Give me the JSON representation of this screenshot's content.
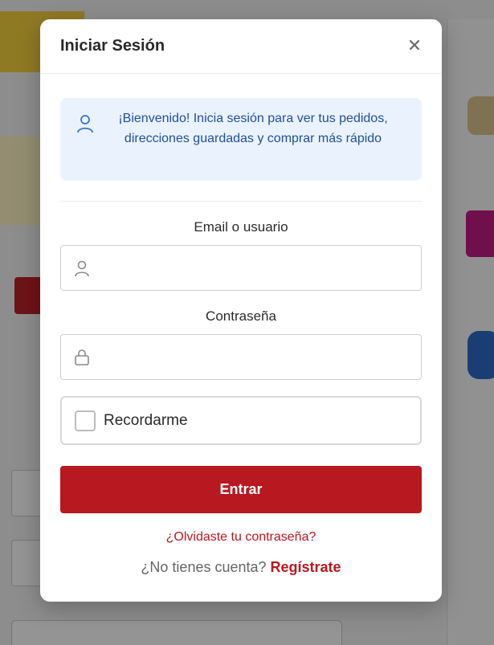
{
  "modal": {
    "title": "Iniciar Sesión",
    "close_icon": "close-icon",
    "info": {
      "icon": "user-icon",
      "text": "¡Bienvenido! Inicia sesión para ver tus pedidos, direcciones guardadas y comprar más rápido"
    },
    "email": {
      "label": "Email o usuario",
      "icon": "user-icon",
      "value": "",
      "placeholder": ""
    },
    "password": {
      "label": "Contraseña",
      "icon": "lock-icon",
      "value": "",
      "placeholder": ""
    },
    "remember": {
      "label": "Recordarme",
      "checked": false
    },
    "submit_label": "Entrar",
    "forgot_label": "¿Olvidaste tu contraseña?",
    "signup_prompt": "¿No tienes cuenta?",
    "signup_label": "Regístrate"
  },
  "colors": {
    "accent": "#b8181f",
    "info_bg": "#eaf3fd",
    "info_text": "#1f4f9e"
  }
}
